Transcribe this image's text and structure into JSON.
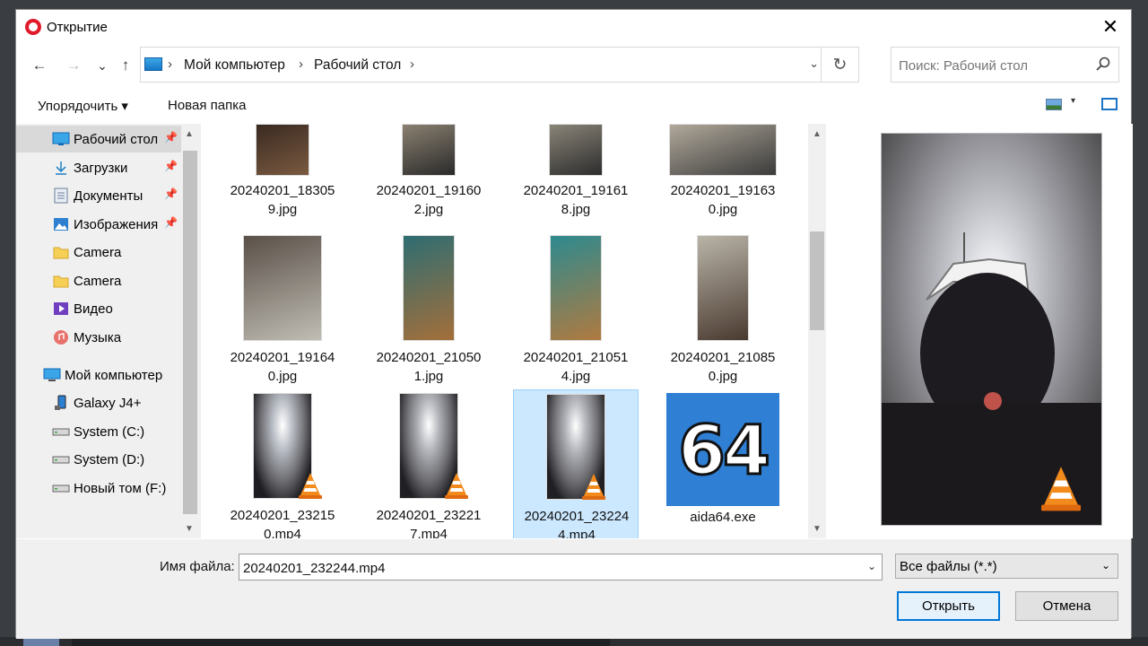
{
  "window": {
    "title": "Открытие",
    "close_glyph": "✕"
  },
  "nav": {
    "back_glyph": "←",
    "forward_glyph": "→",
    "recent_glyph": "⌄",
    "up_glyph": "↑"
  },
  "address": {
    "crumbs": [
      "Мой компьютер",
      "Рабочий стол"
    ],
    "separator": "›",
    "dropdown_glyph": "⌄",
    "refresh_glyph": "↻"
  },
  "search": {
    "placeholder": "Поиск: Рабочий стол"
  },
  "toolbar": {
    "organize_label": "Упорядочить ▾",
    "new_folder_label": "Новая папка",
    "view_dropdown_glyph": "▾"
  },
  "sidebar": {
    "items": [
      {
        "label": "Рабочий стол",
        "icon": "desktop-icon",
        "pinned": true,
        "selected": true
      },
      {
        "label": "Загрузки",
        "icon": "download-icon",
        "pinned": true
      },
      {
        "label": "Документы",
        "icon": "documents-icon",
        "pinned": true
      },
      {
        "label": "Изображения",
        "icon": "pictures-icon",
        "pinned": true
      },
      {
        "label": "Camera",
        "icon": "folder-icon"
      },
      {
        "label": "Camera",
        "icon": "folder-icon"
      },
      {
        "label": "Видео",
        "icon": "videos-icon"
      },
      {
        "label": "Музыка",
        "icon": "music-icon"
      },
      {
        "label": "Мой компьютер",
        "icon": "computer-icon"
      },
      {
        "label": "Galaxy J4+",
        "icon": "phone-icon"
      },
      {
        "label": "System (C:)",
        "icon": "drive-icon"
      },
      {
        "label": "System (D:)",
        "icon": "drive-icon"
      },
      {
        "label": "Новый том (F:)",
        "icon": "drive-icon"
      }
    ],
    "pin_glyph": "📌",
    "scroll_up_glyph": "▲",
    "scroll_down_glyph": "▼"
  },
  "files": {
    "items": [
      {
        "line1": "20240201_18305",
        "line2": "9.jpg",
        "type": "photo",
        "colors": [
          "#3a2a22",
          "#7a5a40"
        ]
      },
      {
        "line1": "20240201_19160",
        "line2": "2.jpg",
        "type": "photo",
        "colors": [
          "#8a8070",
          "#2a2a2a"
        ]
      },
      {
        "line1": "20240201_19161",
        "line2": "8.jpg",
        "type": "photo",
        "colors": [
          "#8a8478",
          "#2d2d2d"
        ]
      },
      {
        "line1": "20240201_19163",
        "line2": "0.jpg",
        "type": "photo",
        "colors": [
          "#b0a89a",
          "#3b3b3b"
        ]
      },
      {
        "line1": "20240201_19164",
        "line2": "0.jpg",
        "type": "photo",
        "colors": [
          "#5a5048",
          "#c0bdb4"
        ]
      },
      {
        "line1": "20240201_21050",
        "line2": "1.jpg",
        "type": "photo",
        "colors": [
          "#2e6d72",
          "#a46f3a"
        ]
      },
      {
        "line1": "20240201_21051",
        "line2": "4.jpg",
        "type": "photo",
        "colors": [
          "#2d8a8f",
          "#b07a40"
        ]
      },
      {
        "line1": "20240201_21085",
        "line2": "0.jpg",
        "type": "photo",
        "colors": [
          "#b9b4a8",
          "#4a3a30"
        ]
      },
      {
        "line1": "20240201_23215",
        "line2": "0.mp4",
        "type": "video",
        "colors": [
          "#b8bcc4",
          "#1e1e22"
        ]
      },
      {
        "line1": "20240201_23221",
        "line2": "7.mp4",
        "type": "video",
        "colors": [
          "#b4b6bc",
          "#202024"
        ]
      },
      {
        "line1": "20240201_23224",
        "line2": "4.mp4",
        "type": "video",
        "colors": [
          "#b4b6bc",
          "#202024"
        ],
        "selected": true
      },
      {
        "line1": "aida64.exe",
        "line2": "",
        "type": "exe",
        "badge": "64",
        "colors": [
          "#2f7fd4",
          "#ffffff"
        ]
      }
    ],
    "scroll_up_glyph": "▲",
    "scroll_down_glyph": "▼"
  },
  "preview": {
    "colors": [
      "#c9cbd0",
      "#1b1b1f"
    ]
  },
  "bottom": {
    "filename_label": "Имя файла:",
    "filename_value": "20240201_232244.mp4",
    "filter_label": "Все файлы (*.*)",
    "dropdown_glyph": "⌄",
    "open_label": "Открыть",
    "cancel_label": "Отмена"
  }
}
